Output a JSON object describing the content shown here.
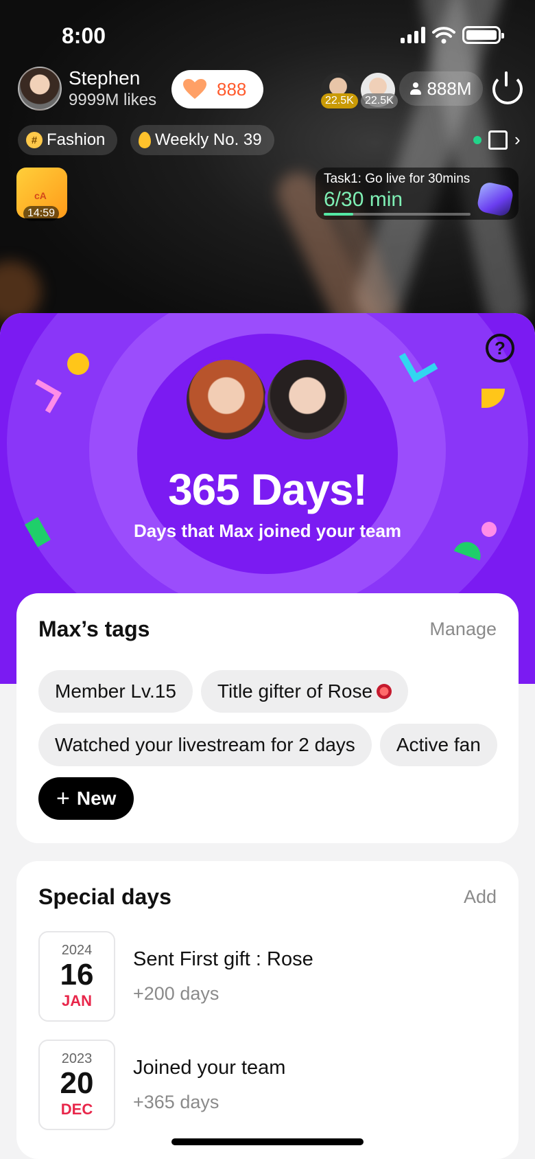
{
  "status": {
    "time": "8:00"
  },
  "host": {
    "name": "Stephen",
    "likes": "9999M likes"
  },
  "hearts": {
    "count": "888"
  },
  "top_viewers": [
    "22.5K",
    "22.5K"
  ],
  "viewer_count": "888M",
  "chips": {
    "category": "Fashion",
    "weekly": "Weekly No. 39"
  },
  "gift": {
    "timer": "14:59",
    "brand_mark": "cA"
  },
  "task": {
    "title": "Task1: Go live for 30mins",
    "progress": "6/30 min",
    "progress_fraction": 0.2
  },
  "hero": {
    "title": "365 Days!",
    "subtitle": "Days that Max joined your team"
  },
  "tags_card": {
    "title": "Max’s tags",
    "action": "Manage",
    "tags": [
      "Member Lv.15",
      "Title gifter of Rose",
      "Watched your livestream for 2 days",
      "Active fan"
    ],
    "new_label": "New"
  },
  "days_card": {
    "title": "Special days",
    "action": "Add",
    "items": [
      {
        "year": "2024",
        "day": "16",
        "month": "JAN",
        "title": "Sent First gift : Rose",
        "count": "+200 days"
      },
      {
        "year": "2023",
        "day": "20",
        "month": "DEC",
        "title": "Joined your team",
        "count": "+365 days"
      }
    ]
  },
  "colors": {
    "accent": "#7b1bf2",
    "brand_orange": "#ff5a2c",
    "date_red": "#e8264a",
    "progress_green": "#55e8a4"
  },
  "icons": [
    "signal-icon",
    "wifi-icon",
    "battery-icon",
    "heart-icon",
    "user-icon",
    "power-icon",
    "hashtag-icon",
    "flame-icon",
    "live-dot-icon",
    "home-icon",
    "chevron-right-icon",
    "gift-icon",
    "gem-icon",
    "help-icon",
    "plus-icon",
    "rose-icon"
  ]
}
